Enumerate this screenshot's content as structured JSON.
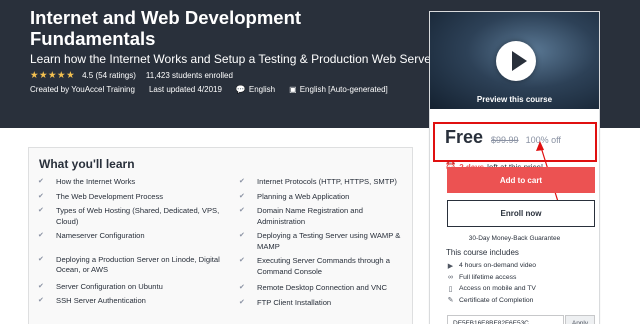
{
  "course": {
    "title": "Internet and Web Development Fundamentals",
    "subtitle": "Learn how the Internet Works and Setup a Testing & Production Web Server",
    "stars": "★★★★★",
    "rating": "4.5",
    "ratings_count": "(54 ratings)",
    "students": "11,423 students enrolled",
    "created_by": "Created by YouAccel Training",
    "last_updated": "Last updated 4/2019",
    "language": "English",
    "captions": "English [Auto-generated]"
  },
  "sidebar": {
    "preview_label": "Preview this course",
    "price": "Free",
    "original_price": "$99.99",
    "discount": "100% off",
    "deadline_bold": "2 days",
    "deadline_rest": "left at this price!",
    "add_to_cart": "Add to cart",
    "enroll_now": "Enroll now",
    "guarantee": "30-Day Money-Back Guarantee",
    "includes_title": "This course includes",
    "includes": [
      {
        "icon": "video-icon",
        "text": "4 hours on-demand video"
      },
      {
        "icon": "infinity-icon",
        "text": "Full lifetime access"
      },
      {
        "icon": "mobile-tv-icon",
        "text": "Access on mobile and TV"
      },
      {
        "icon": "certificate-icon",
        "text": "Certificate of Completion"
      }
    ],
    "coupon_code": "DE5FB16E8BE82F6E53C",
    "apply_label": "Apply"
  },
  "learn": {
    "title": "What you'll learn",
    "left": [
      "How the Internet Works",
      "The Web Development Process",
      "Types of Web Hosting (Shared, Dedicated, VPS, Cloud)",
      "Nameserver Configuration",
      "Deploying a Production Server on Linode, Digital Ocean, or AWS",
      "Server Configuration on Ubuntu",
      "SSH Server Authentication"
    ],
    "right": [
      "Internet Protocols (HTTP, HTTPS, SMTP)",
      "Planning a Web Application",
      "Domain Name Registration and Administration",
      "Deploying a Testing Server using WAMP & MAMP",
      "Executing Server Commands through a Command Console",
      "Remote Desktop Connection and VNC",
      "FTP Client Installation"
    ]
  },
  "colors": {
    "hero_bg": "#29303b",
    "accent_red": "#ec5252",
    "star": "#f4c150",
    "annotation": "#e01010"
  }
}
